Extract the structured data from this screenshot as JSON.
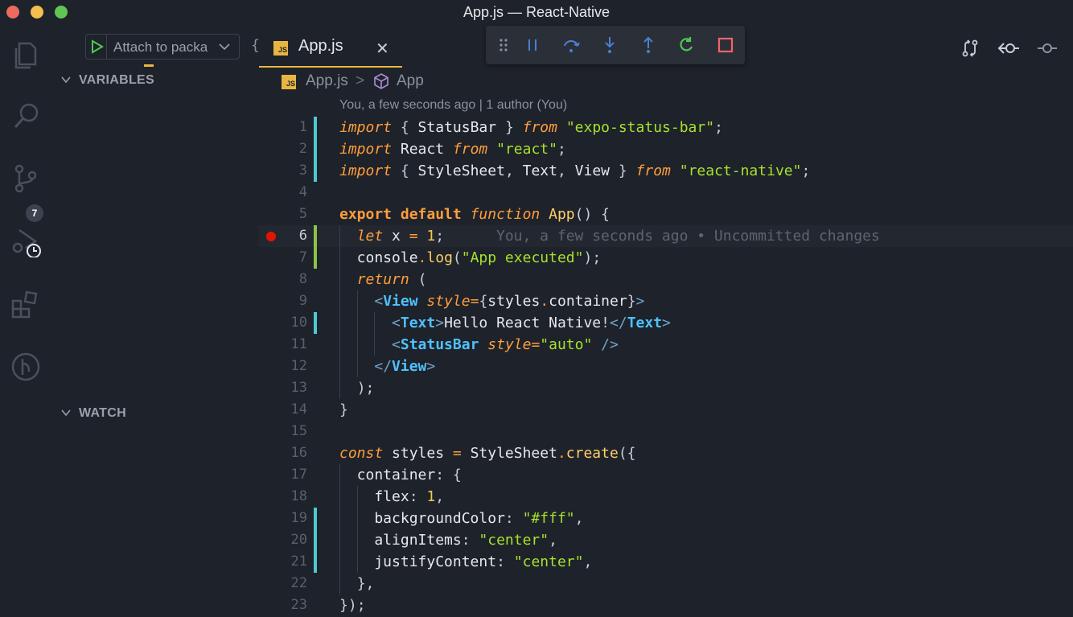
{
  "window": {
    "title": "App.js — React-Native"
  },
  "activity": {
    "scm_badge": "7"
  },
  "debug": {
    "config_label": "Attach to packa",
    "gear_fragment": "{"
  },
  "sidebar": {
    "sections": [
      {
        "label": "VARIABLES"
      },
      {
        "label": "WATCH"
      }
    ]
  },
  "tab": {
    "label": "App.js",
    "badge": "JS",
    "close": "✕"
  },
  "breadcrumb": {
    "file": "App.js",
    "separator": ">",
    "symbol": "App",
    "badge": "JS"
  },
  "blame_header": "You, a few seconds ago | 1 author (You)",
  "inline_blame": "You, a few seconds ago • Uncommitted changes",
  "code": {
    "line_numbers": [
      "1",
      "2",
      "3",
      "4",
      "5",
      "6",
      "7",
      "8",
      "9",
      "10",
      "11",
      "12",
      "13",
      "14",
      "15",
      "16",
      "17",
      "18",
      "19",
      "20",
      "21",
      "22",
      "23"
    ],
    "lines": [
      "import { StatusBar } from \"expo-status-bar\";",
      "import React from \"react\";",
      "import { StyleSheet, Text, View } from \"react-native\";",
      "",
      "export default function App() {",
      "  let x = 1;",
      "  console.log(\"App executed\");",
      "  return (",
      "    <View style={styles.container}>",
      "      <Text>Hello React Native!</Text>",
      "      <StatusBar style=\"auto\" />",
      "    </View>",
      "  );",
      "}",
      "",
      "const styles = StyleSheet.create({",
      "  container: {",
      "    flex: 1,",
      "    backgroundColor: \"#fff\",",
      "    alignItems: \"center\",",
      "    justifyContent: \"center\",",
      "  },",
      "});"
    ],
    "breakpoint_line": 6,
    "modified_lines": [
      1,
      2,
      3,
      10,
      19,
      20,
      21
    ],
    "added_lines": [
      6,
      7
    ]
  },
  "colors": {
    "accent": "#e8b640",
    "breakpoint": "#e51400",
    "gutter_modified": "#4ec9d4",
    "gutter_added": "#8bc34a",
    "keyword": "#ff9e3b",
    "string": "#a6e22e"
  },
  "icons": {
    "activity": [
      "explorer-icon",
      "search-icon",
      "source-control-icon",
      "run-debug-icon",
      "extensions-icon",
      "remote-icon"
    ],
    "debug_toolbar": [
      "drag-handle-icon",
      "pause-icon",
      "step-over-icon",
      "step-into-icon",
      "step-out-icon",
      "restart-icon",
      "stop-icon"
    ],
    "editor_actions": [
      "compare-changes-icon",
      "previous-change-icon",
      "timeline-icon"
    ]
  }
}
